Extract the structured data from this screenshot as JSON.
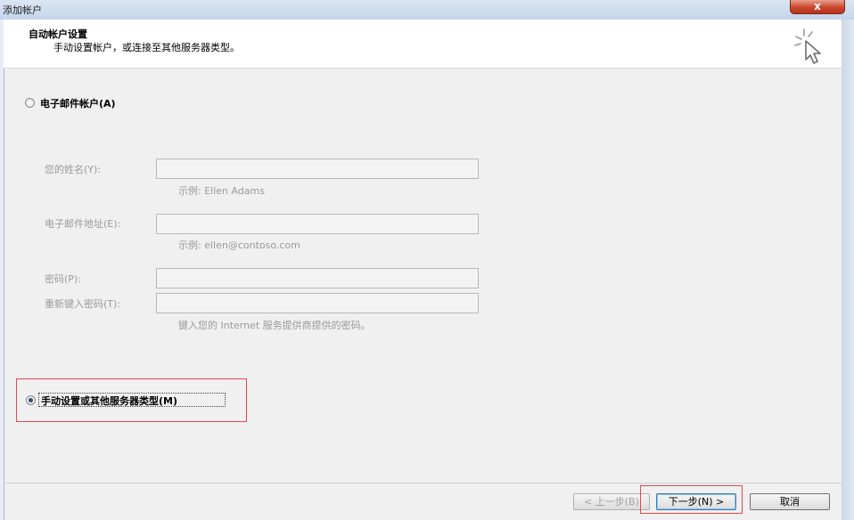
{
  "window": {
    "title": "添加帐户",
    "close_label": "x"
  },
  "header": {
    "heading": "自动帐户设置",
    "subheading": "手动设置帐户，或连接至其他服务器类型。",
    "icon": "wizard-cursor-icon"
  },
  "email_option": {
    "label": "电子邮件帐户(A)",
    "selected": false
  },
  "fields": {
    "name_label": "您的姓名(Y):",
    "name_value": "",
    "name_hint": "示例: Ellen Adams",
    "email_label": "电子邮件地址(E):",
    "email_value": "",
    "email_hint": "示例: ellen@contoso.com",
    "password_label": "密码(P):",
    "password_value": "",
    "retype_label": "重新键入密码(T):",
    "retype_value": "",
    "password_hint": "键入您的 Internet 服务提供商提供的密码。"
  },
  "manual_option": {
    "label": "手动设置或其他服务器类型(M)",
    "selected": true
  },
  "buttons": {
    "back": "< 上一步(B)",
    "next": "下一步(N) >",
    "cancel": "取消"
  },
  "colors": {
    "highlight": "#e0484f",
    "title_gradient_top": "#dbe6f3",
    "close_button": "#c8472c"
  }
}
